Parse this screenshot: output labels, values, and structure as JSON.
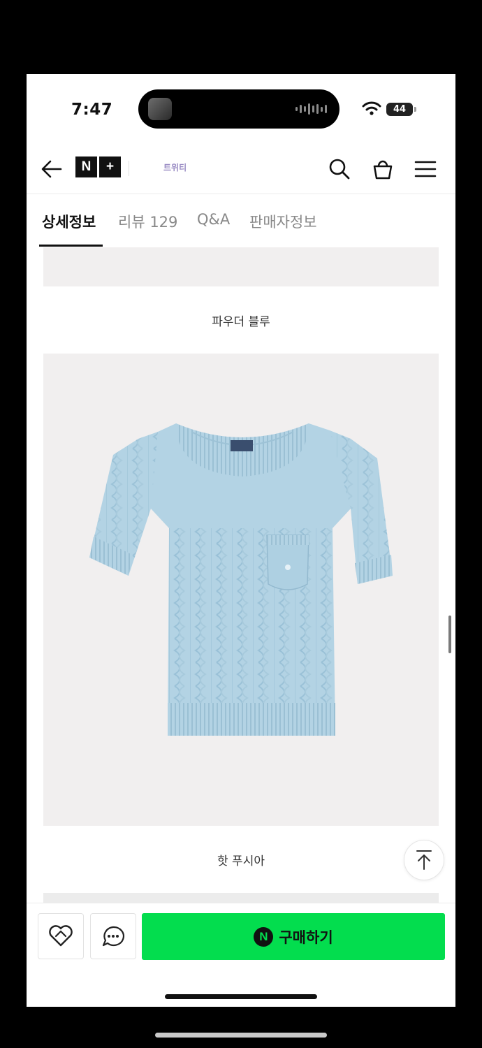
{
  "status": {
    "time": "7:47",
    "battery": "44"
  },
  "header": {
    "logo_n": "N",
    "logo_plus": "+",
    "brand": "트위티"
  },
  "tabs": [
    {
      "label": "상세정보"
    },
    {
      "label": "리뷰 129"
    },
    {
      "label": "Q&A"
    },
    {
      "label": "판매자정보"
    }
  ],
  "content": {
    "caption_1": "파우더 블루",
    "caption_2": "핫 푸시아",
    "product_color": "#b3d3e4"
  },
  "bottom_bar": {
    "buy_icon": "N",
    "buy_label": "구매하기",
    "buy_color": "#03dd4e"
  },
  "icons": {
    "back": "arrow-left-icon",
    "search": "search-icon",
    "cart": "shopping-bag-icon",
    "menu": "hamburger-menu-icon",
    "like": "heart-icon",
    "chat": "chat-bubble-icon",
    "top": "arrow-up-icon"
  }
}
